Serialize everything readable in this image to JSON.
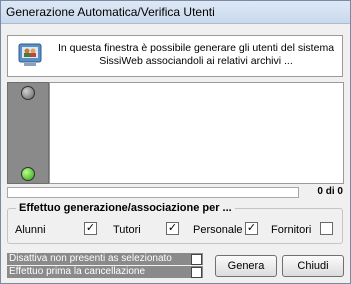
{
  "window": {
    "title": "Generazione Automatica/Verifica Utenti"
  },
  "info": {
    "icon": "users-computer-icon",
    "text": "In questa finestra è possibile generare gli utenti del sistema\nSissiWeb associandoli ai relativi archivi ..."
  },
  "status": {
    "top_led": "grey-led-icon",
    "bottom_led": "green-led-icon",
    "led_green": "#2e9e12"
  },
  "progress": {
    "count_label": "0 di 0",
    "fraction": 0
  },
  "group": {
    "title": "Effettuo generazione/associazione per ...",
    "options": [
      {
        "label": "Alunni",
        "checked": true
      },
      {
        "label": "Tutori",
        "checked": true
      },
      {
        "label": "Personale",
        "checked": true
      },
      {
        "label": "Fornitori",
        "checked": false
      }
    ]
  },
  "extra_options": [
    {
      "label": "Disattiva non presenti as selezionato",
      "checked": false
    },
    {
      "label": "Effettuo prima la cancellazione",
      "checked": false
    }
  ],
  "buttons": {
    "generate": "Genera",
    "close": "Chiudi"
  }
}
